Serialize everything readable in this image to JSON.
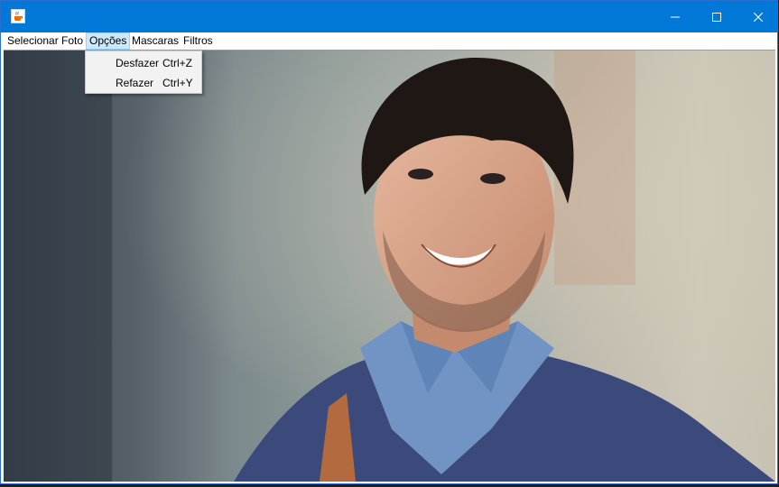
{
  "window": {
    "title": "",
    "controls": {
      "minimize": "minimize",
      "maximize": "maximize",
      "close": "close"
    }
  },
  "menubar": {
    "items": [
      {
        "label": "Selecionar Foto"
      },
      {
        "label": "Opções"
      },
      {
        "label": "Mascaras"
      },
      {
        "label": "Filtros"
      }
    ]
  },
  "dropdown": {
    "items": [
      {
        "label": "Desfazer",
        "accelerator": "Ctrl+Z"
      },
      {
        "label": "Refazer",
        "accelerator": "Ctrl+Y"
      }
    ]
  },
  "colors": {
    "titlebar": "#0078d7",
    "menu_highlight": "#cce8ff"
  }
}
